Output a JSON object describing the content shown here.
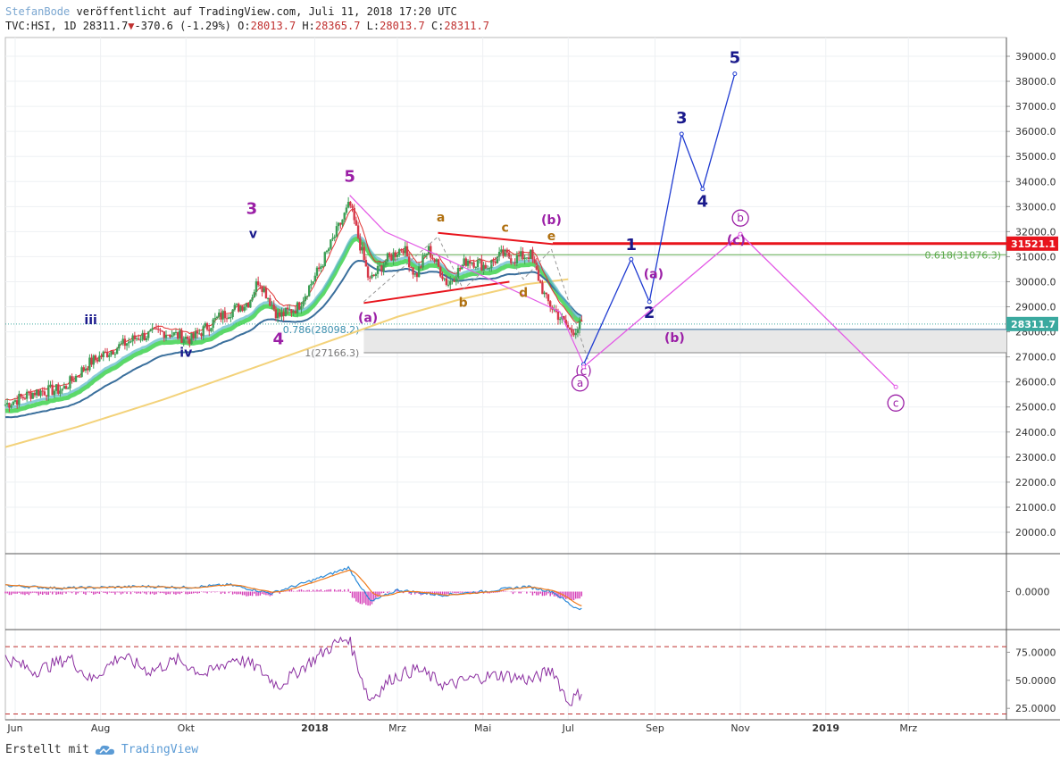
{
  "header": {
    "author": "StefanBode",
    "published": "veröffentlicht auf TradingView.com, Juli 11, 2018 17:20 UTC",
    "symbol": "TVC:HSI, 1D",
    "last": "28311.7",
    "change": "-370.6 (-1.29%)",
    "o_label": "O:",
    "o": "28013.7",
    "h_label": "H:",
    "h": "28365.7",
    "l_label": "L:",
    "l": "28013.7",
    "c_label": "C:",
    "c": "28311.7"
  },
  "footer": {
    "created_with": "Erstellt mit",
    "brand": "TradingView"
  },
  "colors": {
    "up": "#3c9f56",
    "down": "#d6394a",
    "ema_fast": "#e03030",
    "band_green": "#33d044",
    "ema_teal": "#5ab7c9",
    "ema_slow": "#3a6f9c",
    "sma200": "#f3d27a",
    "wave_blue": "#1f3bd1",
    "wave_magenta": "#e35ae6",
    "label_purple": "#9b1fa6",
    "label_brown": "#b07010",
    "navy": "#1a1a8c",
    "red_line": "#e8141c",
    "fib_green": "#5aa84a"
  },
  "chart_data": [
    {
      "type": "line",
      "title": "",
      "ylim": [
        19000,
        39600
      ],
      "y_ticks": [
        20000,
        21000,
        22000,
        23000,
        24000,
        25000,
        26000,
        27000,
        28000,
        29000,
        30000,
        31000,
        32000,
        33000,
        34000,
        35000,
        36000,
        37000,
        38000,
        39000
      ],
      "y_tick_labels": [
        "20000.0",
        "21000.0",
        "22000.0",
        "23000.0",
        "24000.0",
        "25000.0",
        "26000.0",
        "27000.0",
        "28000.0",
        "29000.0",
        "30000.0",
        "31000.0",
        "32000.0",
        "33000.0",
        "34000.0",
        "35000.0",
        "36000.0",
        "37000.0",
        "38000.0",
        "39000.0"
      ],
      "x_ticks": [
        "Jun",
        "Aug",
        "Okt",
        "2018",
        "Mrz",
        "Mai",
        "Jul",
        "Sep",
        "Nov",
        "2019",
        "Mrz"
      ],
      "x_tick_dates": [
        "2017-06",
        "2017-08",
        "2017-10",
        "2018-01",
        "2018-03",
        "2018-05",
        "2018-07",
        "2018-09",
        "2018-11",
        "2019-01",
        "2019-03"
      ],
      "x_range": [
        "2017-05-25",
        "2019-05-10"
      ],
      "series": [
        {
          "role": "price",
          "x": [
            "2017-05-25",
            "2017-06-15",
            "2017-07-05",
            "2017-07-25",
            "2017-08-10",
            "2017-08-28",
            "2017-09-15",
            "2017-10-05",
            "2017-10-25",
            "2017-11-15",
            "2017-11-22",
            "2017-12-06",
            "2017-12-20",
            "2018-01-05",
            "2018-01-15",
            "2018-01-26",
            "2018-02-09",
            "2018-02-20",
            "2018-03-05",
            "2018-03-14",
            "2018-03-23",
            "2018-04-06",
            "2018-04-20",
            "2018-05-04",
            "2018-05-15",
            "2018-05-23",
            "2018-06-04",
            "2018-06-15",
            "2018-06-22",
            "2018-07-03",
            "2018-07-11"
          ],
          "values": [
            25100,
            25600,
            25700,
            26800,
            27300,
            27800,
            28000,
            27700,
            28600,
            29200,
            30100,
            28600,
            29000,
            30600,
            31800,
            33100,
            30000,
            30800,
            31400,
            30200,
            31300,
            29900,
            30900,
            30600,
            31100,
            30900,
            31100,
            29300,
            28800,
            28000,
            28311.7
          ]
        },
        {
          "role": "sma200",
          "x": [
            "2017-05-25",
            "2017-07-15",
            "2017-09-15",
            "2017-11-15",
            "2018-01-15",
            "2018-03-01",
            "2018-04-15",
            "2018-06-01",
            "2018-07-01"
          ],
          "values": [
            23400,
            24200,
            25300,
            26500,
            27700,
            28600,
            29300,
            29900,
            30100
          ]
        }
      ],
      "fib_levels": [
        {
          "label": "0.618(31076.3)",
          "value": 31076.3
        },
        {
          "label": "0.786(28098.2)",
          "value": 28098.2
        },
        {
          "label": "1(27166.3)",
          "value": 27166.3
        }
      ],
      "price_tags": [
        {
          "label": "31521.1",
          "value": 31521.1
        },
        {
          "label": "28311.7",
          "value": 28311.7
        }
      ],
      "triangle_lines": [
        {
          "x": [
            "2018-02-05",
            "2018-05-20"
          ],
          "values": [
            29150,
            30000
          ]
        },
        {
          "x": [
            "2018-03-30",
            "2018-06-20"
          ],
          "values": [
            31950,
            31500
          ]
        }
      ],
      "blue_wave": {
        "x": [
          "2018-07-12",
          "2018-08-15",
          "2018-08-28",
          "2018-09-20",
          "2018-10-05",
          "2018-10-28"
        ],
        "values": [
          26700,
          30900,
          29200,
          35900,
          33700,
          38300
        ],
        "labels": [
          "(c)",
          "1",
          "2",
          "3",
          "4",
          "5"
        ]
      },
      "magenta_wave": {
        "x": [
          "2018-07-12",
          "2018-11-01",
          "2019-02-20"
        ],
        "values": [
          26600,
          31900,
          25800
        ],
        "labels": [
          "a",
          "b",
          "c"
        ]
      },
      "wave_labels": [
        {
          "text": "iii",
          "date": "2017-07-25",
          "value": 28300,
          "style": "navy"
        },
        {
          "text": "iv",
          "date": "2017-10-01",
          "value": 27000,
          "style": "navy"
        },
        {
          "text": "v",
          "date": "2017-11-18",
          "value": 31750,
          "style": "navy"
        },
        {
          "text": "3",
          "date": "2017-11-17",
          "value": 32700,
          "style": "purple"
        },
        {
          "text": "4",
          "date": "2017-12-06",
          "value": 27500,
          "style": "purple"
        },
        {
          "text": "5",
          "date": "2018-01-26",
          "value": 34000,
          "style": "purple"
        },
        {
          "text": "(a)",
          "date": "2018-02-08",
          "value": 28400,
          "style": "purple"
        },
        {
          "text": "a",
          "date": "2018-04-01",
          "value": 32400,
          "style": "brown"
        },
        {
          "text": "b",
          "date": "2018-04-17",
          "value": 29000,
          "style": "brown"
        },
        {
          "text": "c",
          "date": "2018-05-17",
          "value": 32000,
          "style": "brown"
        },
        {
          "text": "d",
          "date": "2018-05-30",
          "value": 29400,
          "style": "brown"
        },
        {
          "text": "e",
          "date": "2018-06-19",
          "value": 31650,
          "style": "brown"
        },
        {
          "text": "(b)",
          "date": "2018-06-19",
          "value": 32300,
          "style": "purple"
        },
        {
          "text": "(a)",
          "date": "2018-08-31",
          "value": 30150,
          "style": "purple"
        },
        {
          "text": "(b)",
          "date": "2018-09-15",
          "value": 27600,
          "style": "purple"
        },
        {
          "text": "(c)",
          "date": "2018-10-29",
          "value": 31500,
          "style": "purple"
        }
      ]
    },
    {
      "type": "line",
      "title": "",
      "ylim": [
        -1,
        1
      ],
      "y_ticks": [
        0
      ],
      "y_tick_labels": [
        "0.0000"
      ],
      "series": [
        {
          "role": "macd",
          "x": [
            "2017-05-25",
            "2017-07-01",
            "2017-08-01",
            "2017-09-01",
            "2017-10-01",
            "2017-11-01",
            "2017-12-01",
            "2018-01-01",
            "2018-01-25",
            "2018-02-10",
            "2018-03-01",
            "2018-04-01",
            "2018-05-01",
            "2018-06-01",
            "2018-06-20",
            "2018-07-05",
            "2018-07-11"
          ],
          "values": [
            0.18,
            0.1,
            0.12,
            0.15,
            0.12,
            0.2,
            -0.05,
            0.35,
            0.7,
            -0.3,
            0.05,
            -0.1,
            0.0,
            0.15,
            0.0,
            -0.45,
            -0.5
          ]
        }
      ]
    },
    {
      "type": "line",
      "title": "",
      "ylim": [
        18,
        92
      ],
      "y_ticks": [
        25,
        50,
        75
      ],
      "y_tick_labels": [
        "25.0000",
        "50.0000",
        "75.0000"
      ],
      "hlines": [
        80,
        20
      ],
      "series": [
        {
          "role": "rsi",
          "x": [
            "2017-05-25",
            "2017-06-15",
            "2017-07-10",
            "2017-07-25",
            "2017-08-15",
            "2017-09-05",
            "2017-09-25",
            "2017-10-15",
            "2017-11-05",
            "2017-11-20",
            "2017-12-06",
            "2017-12-25",
            "2018-01-15",
            "2018-01-25",
            "2018-02-09",
            "2018-02-25",
            "2018-03-15",
            "2018-04-05",
            "2018-04-25",
            "2018-05-15",
            "2018-06-05",
            "2018-06-20",
            "2018-07-01",
            "2018-07-11"
          ],
          "values": [
            70,
            58,
            70,
            50,
            72,
            58,
            68,
            55,
            70,
            62,
            45,
            63,
            82,
            88,
            32,
            52,
            60,
            45,
            52,
            55,
            50,
            60,
            30,
            40
          ]
        }
      ]
    }
  ]
}
